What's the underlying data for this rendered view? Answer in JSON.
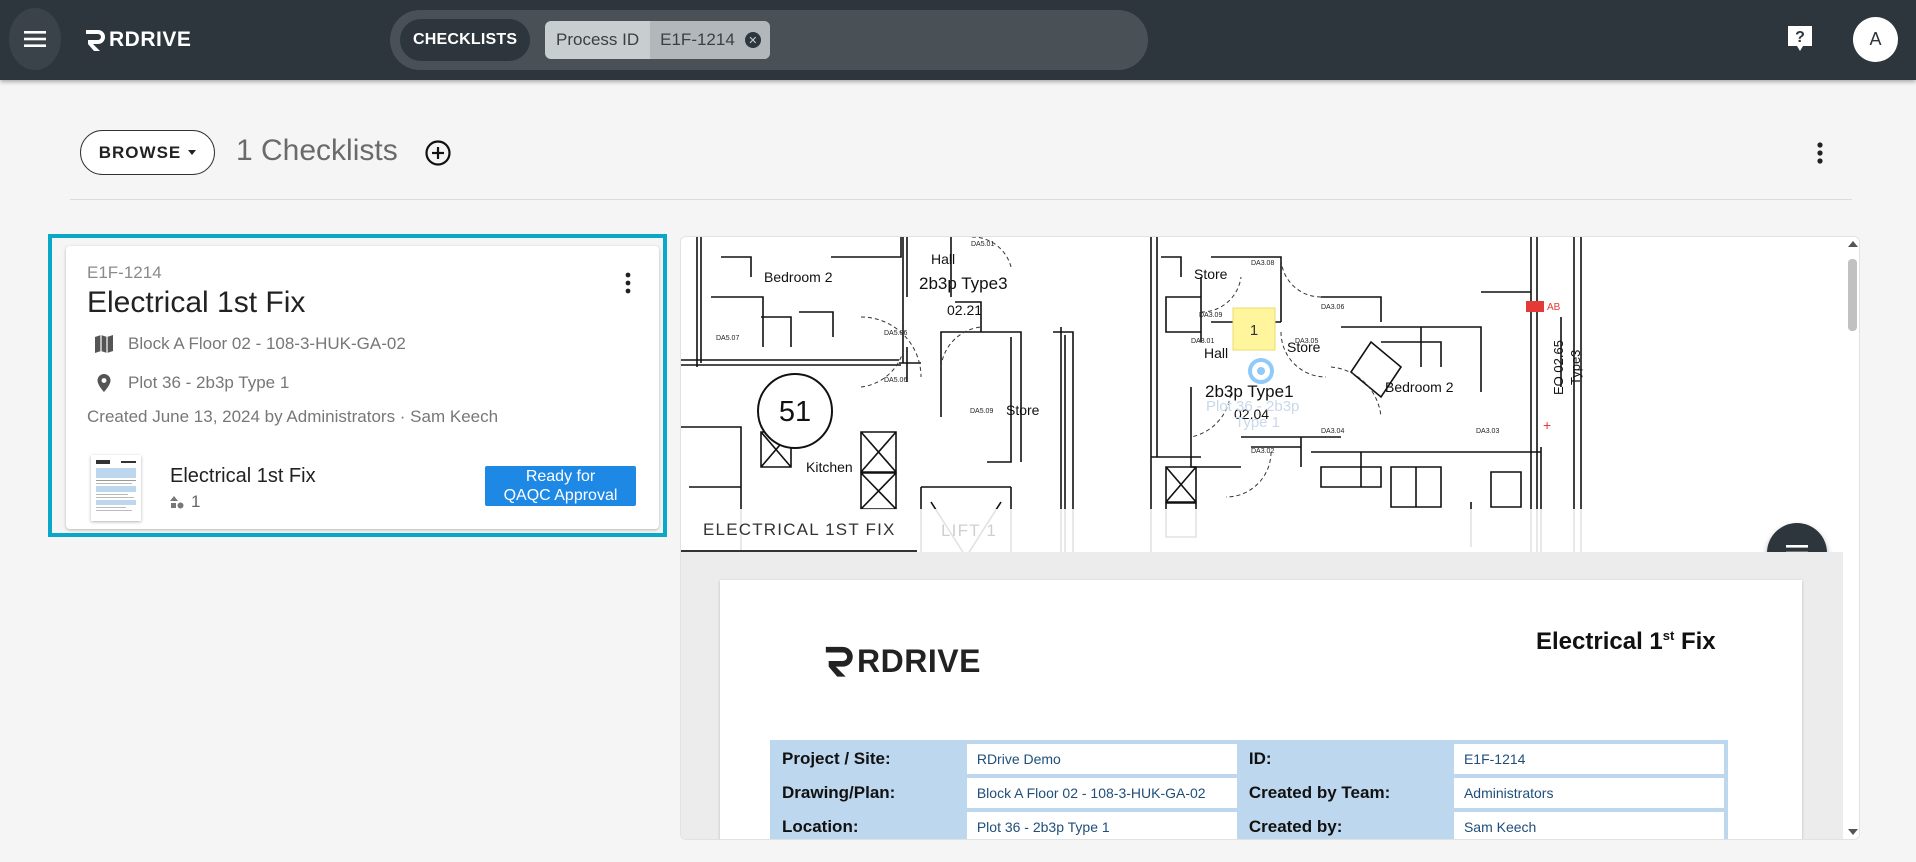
{
  "topbar": {
    "brand": "RDRIVE",
    "scope_chip": "CHECKLISTS",
    "filter": {
      "key": "Process ID",
      "value": "E1F-1214",
      "clear_icon": "close-circle-icon"
    },
    "help_icon": "help-icon",
    "avatar_initial": "A",
    "menu_icon": "hamburger-icon"
  },
  "header": {
    "browse_label": "BROWSE",
    "count_title": "1 Checklists",
    "add_icon": "add-circle-icon",
    "more_icon": "more-vert-icon"
  },
  "card": {
    "id": "E1F-1214",
    "title": "Electrical 1st Fix",
    "drawing": "Block A Floor 02 - 108-3-HUK-GA-02",
    "location": "Plot 36 - 2b3p Type 1",
    "created": "Created June 13, 2024 by Administrators · Sam Keech",
    "form_name": "Electrical 1st Fix",
    "form_count": "1",
    "status": "Ready for QAQC Approval",
    "status_line1": "Ready for",
    "status_line2": "QAQC Approval"
  },
  "preview": {
    "plan_labels": {
      "bedroom2_left": "Bedroom 2",
      "hall_left": "Hall",
      "type_left": "2b3p Type3",
      "room_left": "02.21",
      "plot_no": "51",
      "kitchen": "Kitchen",
      "store_left": "Store",
      "store_mid": "Store",
      "store_right": "Store",
      "hall_right": "Hall",
      "type_right": "2b3p Type1",
      "room_right": "02.04",
      "bedroom2_right": "Bedroom 2",
      "pin": "1",
      "eo": "EO 02.65",
      "type3_vert": "Type3",
      "ab": "AB"
    },
    "tabs": [
      {
        "label": "ELECTRICAL 1ST FIX",
        "active": true
      },
      {
        "label": "LIFT 1",
        "active": false
      }
    ],
    "fab_icon": "list-menu-icon",
    "document": {
      "brand": "RDRIVE",
      "title_main": "Electrical 1",
      "title_sup": "st",
      "title_rest": " Fix",
      "rows": [
        {
          "label_a": "Project / Site:",
          "value_a": "RDrive Demo",
          "label_b": "ID:",
          "value_b": "E1F-1214"
        },
        {
          "label_a": "Drawing/Plan:",
          "value_a": "Block A Floor 02 - 108-3-HUK-GA-02",
          "label_b": "Created by Team:",
          "value_b": "Administrators"
        },
        {
          "label_a": "Location:",
          "value_a": "Plot 36 - 2b3p Type 1",
          "label_b": "Created by:",
          "value_b": "Sam Keech"
        }
      ]
    }
  },
  "colors": {
    "topbar": "#2d363c",
    "card_selected_border": "#0aa7c9",
    "status_badge": "#1e88e5",
    "doc_table_header": "#bdd7ee",
    "pin_note": "#fff59d"
  }
}
